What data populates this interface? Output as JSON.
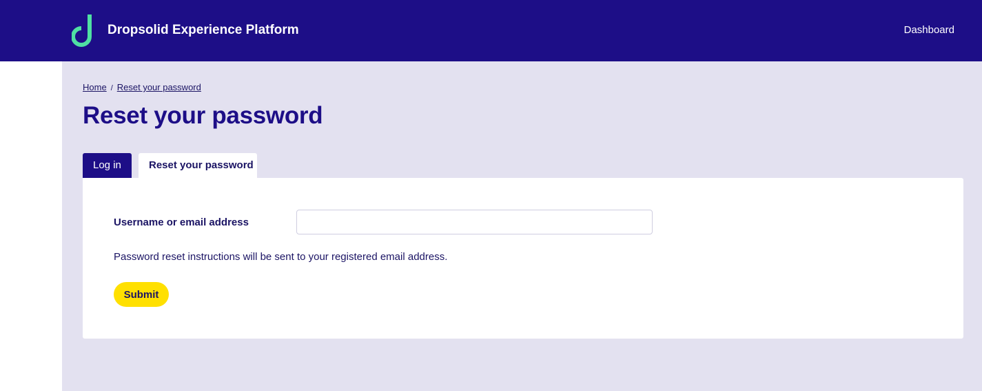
{
  "header": {
    "brand": "Dropsolid Experience Platform",
    "nav_dashboard": "Dashboard",
    "logo_icon": "dropsolid-d-logo-icon",
    "background_color": "#1d0e87",
    "logo_color": "#4fe0a3"
  },
  "breadcrumb": {
    "items": [
      "Home",
      "Reset your password"
    ],
    "separator": "/"
  },
  "page": {
    "title": "Reset your password"
  },
  "tabs": [
    {
      "label": "Log in",
      "active": false
    },
    {
      "label": "Reset your password",
      "active": true
    }
  ],
  "form": {
    "username_label": "Username or email address",
    "username_value": "",
    "help_text": "Password reset instructions will be sent to your registered email address.",
    "submit_label": "Submit",
    "submit_color": "#ffe000"
  },
  "colors": {
    "main_background": "#e3e1f0",
    "text": "#1b1464"
  }
}
